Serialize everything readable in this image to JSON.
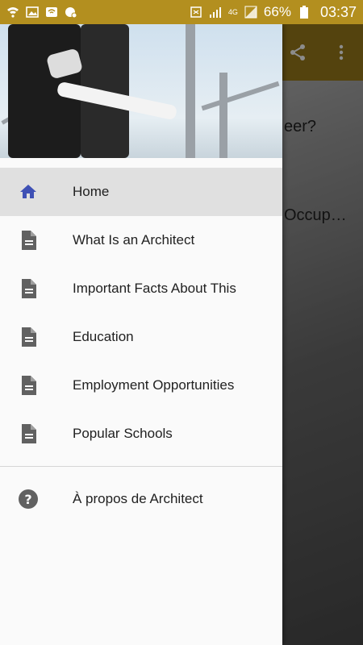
{
  "status_bar": {
    "battery_percent": "66%",
    "time": "03:37",
    "network_label": "4G"
  },
  "background_app": {
    "partial_text_1": "eer?",
    "partial_text_2": "Occup…"
  },
  "drawer": {
    "items": [
      {
        "label": "Home",
        "icon": "home-icon",
        "active": true
      },
      {
        "label": "What Is an Architect",
        "icon": "document-icon"
      },
      {
        "label": "Important Facts About This",
        "icon": "document-icon"
      },
      {
        "label": "Education",
        "icon": "document-icon"
      },
      {
        "label": "Employment Opportunities",
        "icon": "document-icon"
      },
      {
        "label": "Popular Schools",
        "icon": "document-icon"
      }
    ],
    "about": {
      "label": "À propos de Architect",
      "icon": "help-icon"
    }
  },
  "colors": {
    "status_bar": "#b38f1f",
    "toolbar": "#9a7b1b",
    "home_icon": "#3f51b5",
    "doc_icon": "#616161"
  }
}
